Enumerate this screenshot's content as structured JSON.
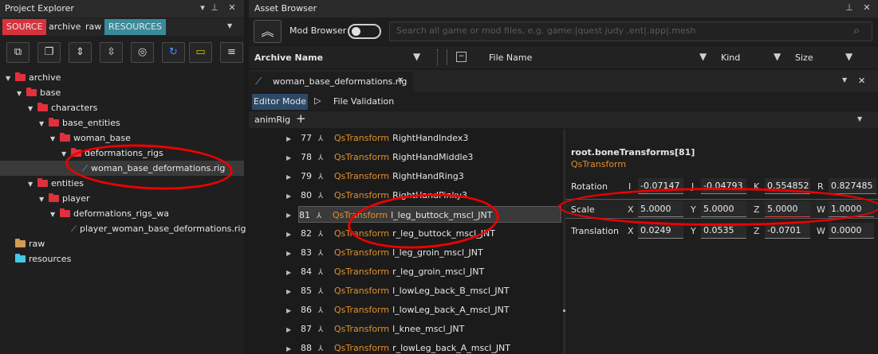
{
  "project_explorer": {
    "title": "Project Explorer",
    "tabs": [
      {
        "label": "SOURCE",
        "bg": "#d8323c"
      },
      {
        "label": "archive",
        "bg": ""
      },
      {
        "label": "raw",
        "bg": ""
      },
      {
        "label": "RESOURCES",
        "bg": "#3a8b9a"
      }
    ],
    "tree": [
      {
        "label": "archive",
        "depth": 0,
        "folder": "red",
        "expanded": true
      },
      {
        "label": "base",
        "depth": 1,
        "folder": "red",
        "expanded": true
      },
      {
        "label": "characters",
        "depth": 2,
        "folder": "red",
        "expanded": true
      },
      {
        "label": "base_entities",
        "depth": 3,
        "folder": "red",
        "expanded": true
      },
      {
        "label": "woman_base",
        "depth": 4,
        "folder": "red",
        "expanded": true
      },
      {
        "label": "deformations_rigs",
        "depth": 5,
        "folder": "red",
        "expanded": true
      },
      {
        "label": "woman_base_deformations.rig",
        "depth": 6,
        "folder": "rig",
        "selected": true
      },
      {
        "label": "entities",
        "depth": 2,
        "folder": "red",
        "expanded": true
      },
      {
        "label": "player",
        "depth": 3,
        "folder": "red",
        "expanded": true
      },
      {
        "label": "deformations_rigs_wa",
        "depth": 4,
        "folder": "red",
        "expanded": true
      },
      {
        "label": "player_woman_base_deformations.rig",
        "depth": 5,
        "folder": "rig"
      },
      {
        "label": "raw",
        "depth": 0,
        "folder": "tan"
      },
      {
        "label": "resources",
        "depth": 0,
        "folder": "cyan"
      }
    ]
  },
  "asset_browser": {
    "title": "Asset Browser",
    "mod_browser_label": "Mod Browser",
    "search_placeholder": "Search all game or mod files, e.g. game:|quest judy .ent|.app|.mesh",
    "columns": {
      "archive_name": "Archive Name",
      "file_name": "File Name",
      "kind": "Kind",
      "size": "Size"
    }
  },
  "editor": {
    "tab_label": "woman_base_deformations.rig",
    "editor_mode": "Editor Mode",
    "file_validation": "File Validation",
    "anim_rig": "animRig",
    "qs_label": "QsTransform",
    "bones": [
      {
        "index": "77",
        "name": "RightHandIndex3"
      },
      {
        "index": "78",
        "name": "RightHandMiddle3"
      },
      {
        "index": "79",
        "name": "RightHandRing3"
      },
      {
        "index": "80",
        "name": "RightHandPinky3"
      },
      {
        "index": "81",
        "name": "l_leg_buttock_mscl_JNT",
        "selected": true
      },
      {
        "index": "82",
        "name": "r_leg_buttock_mscl_JNT"
      },
      {
        "index": "83",
        "name": "l_leg_groin_mscl_JNT"
      },
      {
        "index": "84",
        "name": "r_leg_groin_mscl_JNT"
      },
      {
        "index": "85",
        "name": "l_lowLeg_back_B_mscl_JNT"
      },
      {
        "index": "86",
        "name": "l_lowLeg_back_A_mscl_JNT"
      },
      {
        "index": "87",
        "name": "l_knee_mscl_JNT"
      },
      {
        "index": "88",
        "name": "r_lowLeg_back_A_mscl_JNT"
      }
    ],
    "properties": {
      "path": "root.boneTransforms[81]",
      "type": "QsTransform",
      "rotation": {
        "label": "Rotation",
        "axes": [
          "I",
          "J",
          "K",
          "R"
        ],
        "values": [
          "-0.07147",
          "-0.04793",
          "0.554852",
          "0.827485"
        ]
      },
      "scale": {
        "label": "Scale",
        "axes": [
          "X",
          "Y",
          "Z",
          "W"
        ],
        "values": [
          "5.0000",
          "5.0000",
          "5.0000",
          "1.0000"
        ]
      },
      "translation": {
        "label": "Translation",
        "axes": [
          "X",
          "Y",
          "Z",
          "W"
        ],
        "values": [
          "0.0249",
          "0.0535",
          "-0.0701",
          "0.0000"
        ]
      }
    }
  }
}
